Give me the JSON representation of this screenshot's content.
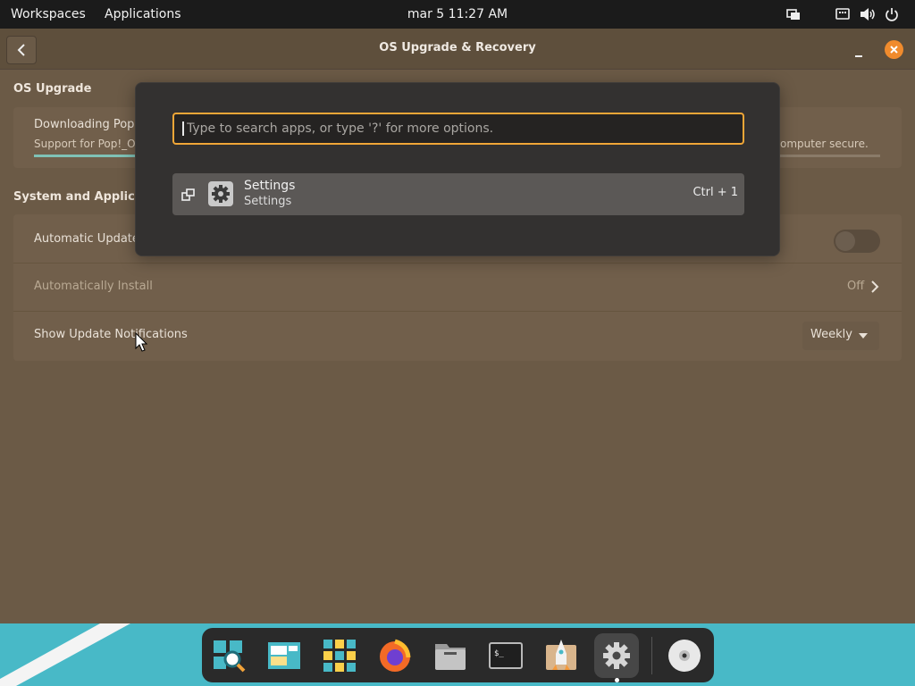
{
  "topbar": {
    "workspaces": "Workspaces",
    "applications": "Applications",
    "clock": "mar 5  11:27 AM",
    "tray_icons": [
      "window-switch-icon",
      "network-icon",
      "volume-icon",
      "power-icon"
    ]
  },
  "window": {
    "title": "OS Upgrade & Recovery",
    "os_upgrade": {
      "section_title": "OS Upgrade",
      "download_title": "Downloading Pop!_",
      "download_sub": "Support for Pop!_OS",
      "download_sub_right": "omputer secure."
    },
    "system": {
      "section_title": "System and Applications",
      "auto_updates_label": "Automatic Updates",
      "auto_updates_on": false,
      "auto_install_label": "Automatically Install",
      "auto_install_value": "Off",
      "notifications_label": "Show Update Notifications",
      "notifications_value": "Weekly"
    }
  },
  "launcher": {
    "placeholder": "Type to search apps, or type '?' for more options.",
    "result": {
      "name": "Settings",
      "description": "Settings",
      "shortcut": "Ctrl + 1"
    }
  },
  "dock": {
    "items": [
      "launcher-icon",
      "workspaces-icon",
      "app-grid-icon",
      "firefox-icon",
      "files-icon",
      "terminal-icon",
      "pop-shop-icon",
      "settings-icon",
      "disc-icon"
    ],
    "active_item": "settings-icon"
  },
  "colors": {
    "accent": "#f0a637",
    "close": "#f08b2d",
    "window_bg": "#6b5a46",
    "launcher_bg": "#333130",
    "desktop": "#48b9c7"
  }
}
